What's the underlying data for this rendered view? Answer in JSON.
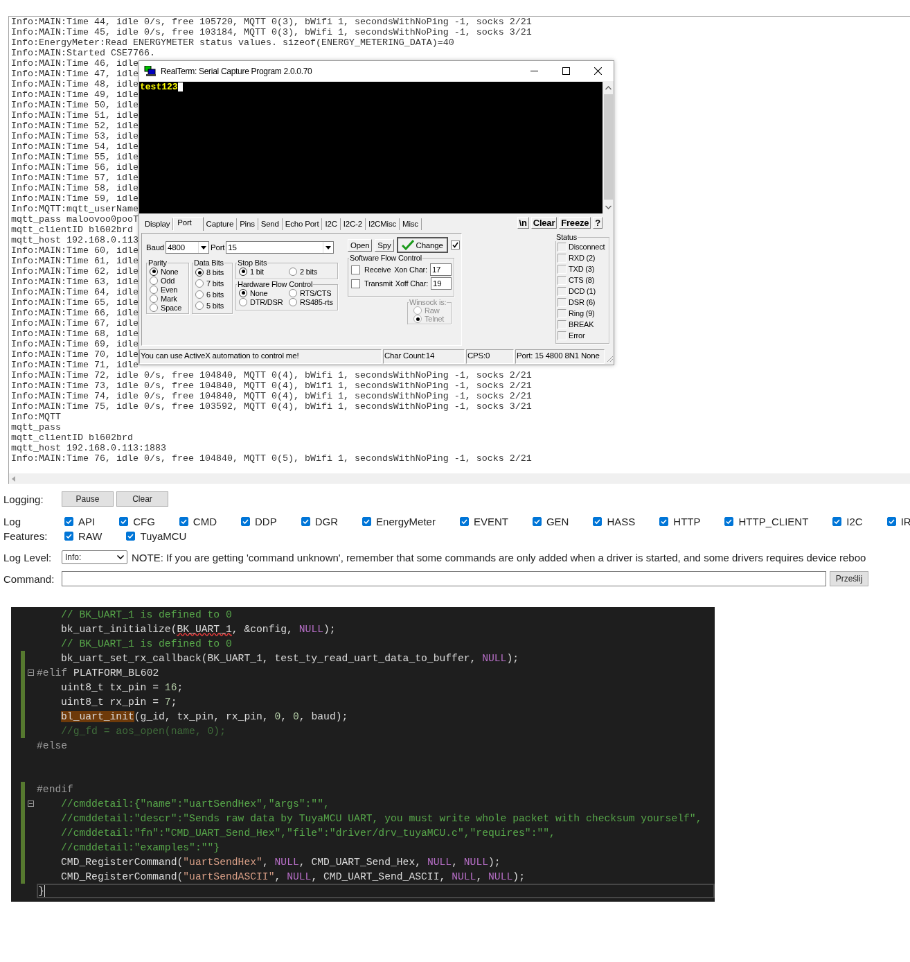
{
  "log": {
    "lines": [
      "Info:MAIN:Time 44, idle 0/s, free 105720, MQTT 0(3), bWifi 1, secondsWithNoPing -1, socks 2/21",
      "Info:MAIN:Time 45, idle 0/s, free 103184, MQTT 0(3), bWifi 1, secondsWithNoPing -1, socks 3/21",
      "Info:EnergyMeter:Read ENERGYMETER status values. sizeof(ENERGY_METERING_DATA)=40",
      "Info:MAIN:Started CSE7766.",
      "Info:MAIN:Time 46, idle",
      "Info:MAIN:Time 47, idle",
      "Info:MAIN:Time 48, idle",
      "Info:MAIN:Time 49, idle",
      "Info:MAIN:Time 50, idle",
      "Info:MAIN:Time 51, idle",
      "Info:MAIN:Time 52, idle",
      "Info:MAIN:Time 53, idle",
      "Info:MAIN:Time 54, idle",
      "Info:MAIN:Time 55, idle",
      "Info:MAIN:Time 56, idle",
      "Info:MAIN:Time 57, idle",
      "Info:MAIN:Time 58, idle",
      "Info:MAIN:Time 59, idle",
      "Info:MQTT:mqtt_userName",
      "mqtt_pass maloovoo0pooT",
      "mqtt_clientID bl602brd",
      "mqtt_host 192.168.0.113",
      "Info:MAIN:Time 60, idle",
      "Info:MAIN:Time 61, idle",
      "Info:MAIN:Time 62, idle",
      "Info:MAIN:Time 63, idle",
      "Info:MAIN:Time 64, idle",
      "Info:MAIN:Time 65, idle",
      "Info:MAIN:Time 66, idle",
      "Info:MAIN:Time 67, idle",
      "Info:MAIN:Time 68, idle",
      "Info:MAIN:Time 69, idle",
      "Info:MAIN:Time 70, idle",
      "Info:MAIN:Time 71, idle",
      "Info:MAIN:Time 72, idle 0/s, free 104840, MQTT 0(4), bWifi 1, secondsWithNoPing -1, socks 2/21",
      "Info:MAIN:Time 73, idle 0/s, free 104840, MQTT 0(4), bWifi 1, secondsWithNoPing -1, socks 2/21",
      "Info:MAIN:Time 74, idle 0/s, free 104840, MQTT 0(4), bWifi 1, secondsWithNoPing -1, socks 2/21",
      "Info:MAIN:Time 75, idle 0/s, free 103592, MQTT 0(4), bWifi 1, secondsWithNoPing -1, socks 3/21",
      "Info:MQTT",
      "mqtt_pass",
      "mqtt_clientID bl602brd",
      "mqtt_host 192.168.0.113:1883",
      "Info:MAIN:Time 76, idle 0/s, free 104840, MQTT 0(5), bWifi 1, secondsWithNoPing -1, socks 2/21"
    ]
  },
  "realterm": {
    "title": "RealTerm: Serial Capture Program 2.0.0.70",
    "terminal_text": "test123",
    "tabs": [
      {
        "label": "Display",
        "selected": false
      },
      {
        "label": "Port",
        "selected": true
      },
      {
        "label": "Capture",
        "selected": false
      },
      {
        "label": "Pins",
        "selected": false
      },
      {
        "label": "Send",
        "selected": false
      },
      {
        "label": "Echo Port",
        "selected": false
      },
      {
        "label": "I2C",
        "selected": false
      },
      {
        "label": "I2C-2",
        "selected": false
      },
      {
        "label": "I2CMisc",
        "selected": false
      },
      {
        "label": "Misc",
        "selected": false
      }
    ],
    "tool_buttons": [
      "\\n",
      "Clear",
      "Freeze",
      "?"
    ],
    "port": {
      "baud_label": "Baud",
      "baud": "4800",
      "port_label": "Port",
      "port": "15",
      "buttons": [
        "Open",
        "Spy"
      ],
      "change": "Change",
      "change_checked": true,
      "parity": {
        "title": "Parity",
        "options": [
          {
            "label": "None",
            "selected": true
          },
          {
            "label": "Odd",
            "selected": false
          },
          {
            "label": "Even",
            "selected": false
          },
          {
            "label": "Mark",
            "selected": false
          },
          {
            "label": "Space",
            "selected": false
          }
        ]
      },
      "data_bits": {
        "title": "Data Bits",
        "options": [
          {
            "label": "8 bits",
            "selected": true
          },
          {
            "label": "7 bits",
            "selected": false
          },
          {
            "label": "6 bits",
            "selected": false
          },
          {
            "label": "5 bits",
            "selected": false
          }
        ]
      },
      "stop_bits": {
        "title": "Stop Bits",
        "options": [
          {
            "label": "1 bit",
            "selected": true
          },
          {
            "label": "2 bits",
            "selected": false
          }
        ]
      },
      "hardware_flow": {
        "title": "Hardware Flow Control",
        "options": [
          {
            "label": "None",
            "selected": true
          },
          {
            "label": "RTS/CTS",
            "selected": false
          },
          {
            "label": "DTR/DSR",
            "selected": false
          },
          {
            "label": "RS485-rts",
            "selected": false
          }
        ]
      },
      "software_flow": {
        "title": "Software Flow Control",
        "rows": [
          {
            "label": "Receive",
            "checked": false,
            "char_label": "Xon Char:",
            "char_value": "17"
          },
          {
            "label": "Transmit",
            "checked": false,
            "char_label": "Xoff Char:",
            "char_value": "19"
          }
        ]
      },
      "winsock": {
        "title": "Winsock is:",
        "disabled": true,
        "options": [
          {
            "label": "Raw",
            "selected": false
          },
          {
            "label": "Telnet",
            "selected": true
          }
        ]
      }
    },
    "status": {
      "title": "Status",
      "lines": [
        {
          "label": "Disconnect",
          "on": false
        },
        {
          "label": "RXD (2)",
          "on": false
        },
        {
          "label": "TXD (3)",
          "on": false
        },
        {
          "label": "CTS (8)",
          "on": false
        },
        {
          "label": "DCD (1)",
          "on": false
        },
        {
          "label": "DSR (6)",
          "on": false
        },
        {
          "label": "Ring (9)",
          "on": false
        },
        {
          "label": "BREAK",
          "on": false
        },
        {
          "label": "Error",
          "on": false
        }
      ]
    },
    "status_bar": [
      "You can use ActiveX automation to control me!",
      "Char Count:14",
      "CPS:0",
      "Port: 15 4800 8N1 None"
    ]
  },
  "logging": {
    "label": "Logging:",
    "buttons": [
      "Pause",
      "Clear"
    ]
  },
  "log_features": {
    "label": "Log Features:",
    "rows": [
      [
        {
          "label": "API",
          "checked": true
        },
        {
          "label": "CFG",
          "checked": true
        },
        {
          "label": "CMD",
          "checked": true
        },
        {
          "label": "DDP",
          "checked": true
        },
        {
          "label": "DGR",
          "checked": true
        },
        {
          "label": "EnergyMeter",
          "checked": true
        },
        {
          "label": "EVENT",
          "checked": true
        },
        {
          "label": "GEN",
          "checked": true
        },
        {
          "label": "HASS",
          "checked": true
        },
        {
          "label": "HTTP",
          "checked": true
        },
        {
          "label": "HTTP_CLIENT",
          "checked": true
        },
        {
          "label": "I2C",
          "checked": true
        },
        {
          "label": "IR",
          "checked": true
        }
      ],
      [
        {
          "label": "RAW",
          "checked": true
        },
        {
          "label": "TuyaMCU",
          "checked": true
        }
      ]
    ]
  },
  "log_level": {
    "label": "Log Level:",
    "value": "Info:",
    "note": "NOTE: If you are getting 'command unknown', remember that some commands are only added when a driver is started, and some drivers requires device reboo"
  },
  "command": {
    "label": "Command:",
    "button": "Prześlij"
  },
  "code_editor": {
    "lines": [
      {
        "indented": true,
        "changed": false,
        "fold": false,
        "current": false,
        "segments": [
          {
            "kind": "comment",
            "text": "// BK_UART_1 is defined to 0"
          }
        ]
      },
      {
        "indented": true,
        "changed": false,
        "fold": false,
        "current": false,
        "segments": [
          {
            "kind": "plain",
            "text": "bk_uart_initialize("
          },
          {
            "kind": "error",
            "text": "BK_UART_1"
          },
          {
            "kind": "plain",
            "text": ", &config, "
          },
          {
            "kind": "keyword",
            "text": "NULL"
          },
          {
            "kind": "plain",
            "text": ");"
          }
        ]
      },
      {
        "indented": true,
        "changed": false,
        "fold": false,
        "current": false,
        "segments": [
          {
            "kind": "comment",
            "text": "// BK_UART_1 is defined to 0"
          }
        ]
      },
      {
        "indented": true,
        "changed": true,
        "fold": false,
        "current": false,
        "segments": [
          {
            "kind": "plain",
            "text": "bk_uart_set_rx_callback(BK_UART_1, test_ty_read_uart_data_to_buffer, "
          },
          {
            "kind": "keyword",
            "text": "NULL"
          },
          {
            "kind": "plain",
            "text": ");"
          }
        ]
      },
      {
        "indented": false,
        "changed": true,
        "fold": true,
        "current": false,
        "segments": [
          {
            "kind": "directive",
            "text": "#elif"
          },
          {
            "kind": "plain",
            "text": " PLATFORM_BL602"
          }
        ]
      },
      {
        "indented": true,
        "changed": true,
        "fold": false,
        "current": false,
        "segments": [
          {
            "kind": "plain",
            "text": "uint8_t tx_pin = "
          },
          {
            "kind": "number",
            "text": "16"
          },
          {
            "kind": "plain",
            "text": ";"
          }
        ]
      },
      {
        "indented": true,
        "changed": true,
        "fold": false,
        "current": false,
        "segments": [
          {
            "kind": "plain",
            "text": "uint8_t rx_pin = "
          },
          {
            "kind": "number",
            "text": "7"
          },
          {
            "kind": "plain",
            "text": ";"
          }
        ]
      },
      {
        "indented": true,
        "changed": true,
        "fold": false,
        "current": false,
        "segments": [
          {
            "kind": "highlight",
            "text": "bl_uart_init"
          },
          {
            "kind": "plain",
            "text": "(g_id, tx_pin, rx_pin, "
          },
          {
            "kind": "number",
            "text": "0"
          },
          {
            "kind": "plain",
            "text": ", "
          },
          {
            "kind": "number",
            "text": "0"
          },
          {
            "kind": "plain",
            "text": ", baud);"
          }
        ]
      },
      {
        "indented": true,
        "changed": true,
        "fold": false,
        "current": false,
        "segments": [
          {
            "kind": "inactive",
            "text": "//g_fd = aos_open(name, 0);"
          }
        ]
      },
      {
        "indented": false,
        "changed": false,
        "fold": false,
        "current": false,
        "segments": [
          {
            "kind": "directive",
            "text": "#else"
          }
        ]
      },
      {
        "changed": false,
        "fold": false,
        "current": false
      },
      {
        "changed": false,
        "fold": false,
        "current": false
      },
      {
        "indented": false,
        "changed": true,
        "fold": false,
        "current": false,
        "segments": [
          {
            "kind": "directive",
            "text": "#endif"
          }
        ]
      },
      {
        "indented": true,
        "changed": true,
        "fold": true,
        "current": false,
        "segments": [
          {
            "kind": "comment",
            "text": "//cmddetail:{\"name\":\"uartSendHex\",\"args\":\"\","
          }
        ]
      },
      {
        "indented": true,
        "changed": true,
        "fold": false,
        "current": false,
        "segments": [
          {
            "kind": "comment",
            "text": "//cmddetail:\"descr\":\"Sends raw data by TuyaMCU UART, you must write whole packet with checksum yourself\","
          }
        ]
      },
      {
        "indented": true,
        "changed": true,
        "fold": false,
        "current": false,
        "segments": [
          {
            "kind": "comment",
            "text": "//cmddetail:\"fn\":\"CMD_UART_Send_Hex\",\"file\":\"driver/drv_tuyaMCU.c\",\"requires\":\"\","
          }
        ]
      },
      {
        "indented": true,
        "changed": true,
        "fold": false,
        "current": false,
        "segments": [
          {
            "kind": "comment",
            "text": "//cmddetail:\"examples\":\"\"}"
          }
        ]
      },
      {
        "indented": true,
        "changed": true,
        "fold": false,
        "current": false,
        "segments": [
          {
            "kind": "plain",
            "text": "CMD_RegisterCommand("
          },
          {
            "kind": "string",
            "text": "\"uartSendHex\""
          },
          {
            "kind": "plain",
            "text": ", "
          },
          {
            "kind": "keyword",
            "text": "NULL"
          },
          {
            "kind": "plain",
            "text": ", CMD_UART_Send_Hex, "
          },
          {
            "kind": "keyword",
            "text": "NULL"
          },
          {
            "kind": "plain",
            "text": ", "
          },
          {
            "kind": "keyword",
            "text": "NULL"
          },
          {
            "kind": "plain",
            "text": ");"
          }
        ]
      },
      {
        "indented": true,
        "changed": true,
        "fold": false,
        "current": false,
        "segments": [
          {
            "kind": "plain",
            "text": "CMD_RegisterCommand("
          },
          {
            "kind": "string",
            "text": "\"uartSendASCII\""
          },
          {
            "kind": "plain",
            "text": ", "
          },
          {
            "kind": "keyword",
            "text": "NULL"
          },
          {
            "kind": "plain",
            "text": ", CMD_UART_Send_ASCII, "
          },
          {
            "kind": "keyword",
            "text": "NULL"
          },
          {
            "kind": "plain",
            "text": ", "
          },
          {
            "kind": "keyword",
            "text": "NULL"
          },
          {
            "kind": "plain",
            "text": ");"
          }
        ]
      },
      {
        "indented": false,
        "changed": false,
        "fold": false,
        "current": true,
        "segments": [
          {
            "kind": "plain",
            "text": "}"
          }
        ]
      }
    ]
  }
}
